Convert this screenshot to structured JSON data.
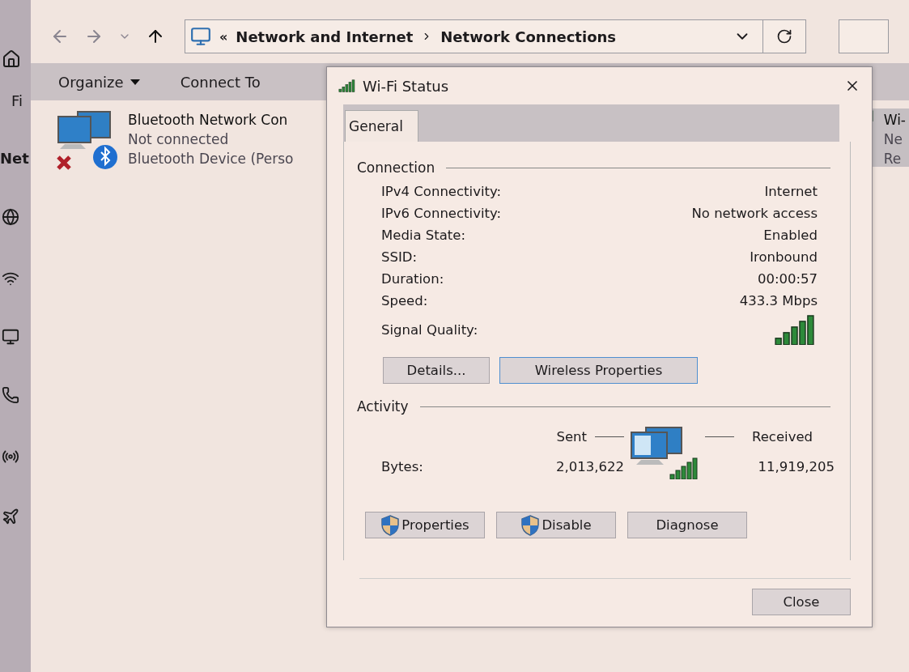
{
  "settings_pane": {
    "search_text": "Fi",
    "heading": "Net"
  },
  "explorer": {
    "overflow": "«",
    "breadcrumb": [
      "Network and Internet",
      "Network Connections"
    ],
    "commands": [
      {
        "label": "Organize",
        "kind": "menu"
      },
      {
        "label": "Connect To",
        "kind": "plain"
      }
    ],
    "connections": [
      {
        "kind": "bluetooth",
        "name": "Bluetooth Network Con",
        "status": "Not connected",
        "device": "Bluetooth Device (Perso",
        "selected": false
      },
      {
        "kind": "wifi",
        "name": "Wi-",
        "status": "Ne",
        "device": "Re",
        "selected": true
      }
    ]
  },
  "dialog": {
    "title": "Wi-Fi Status",
    "tabs": [
      {
        "label": "General",
        "selected": true
      }
    ],
    "connection": {
      "heading": "Connection",
      "rows": [
        {
          "label": "IPv4 Connectivity:",
          "value": "Internet"
        },
        {
          "label": "IPv6 Connectivity:",
          "value": "No network access"
        },
        {
          "label": "Media State:",
          "value": "Enabled"
        },
        {
          "label": "SSID:",
          "value": "Ironbound"
        },
        {
          "label": "Duration:",
          "value": "00:00:57"
        },
        {
          "label": "Speed:",
          "value": "433.3 Mbps"
        }
      ],
      "signal_label": "Signal Quality:",
      "buttons": [
        {
          "label": "Details...",
          "focused": false
        },
        {
          "label": "Wireless Properties",
          "focused": true
        }
      ]
    },
    "activity": {
      "heading": "Activity",
      "sent_label": "Sent",
      "received_label": "Received",
      "bytes_label": "Bytes:",
      "sent": "2,013,622",
      "received": "11,919,205"
    },
    "buttons": [
      {
        "label": "Properties",
        "shield": true
      },
      {
        "label": "Disable",
        "shield": true
      },
      {
        "label": "Diagnose",
        "shield": false
      }
    ],
    "close": "Close"
  }
}
